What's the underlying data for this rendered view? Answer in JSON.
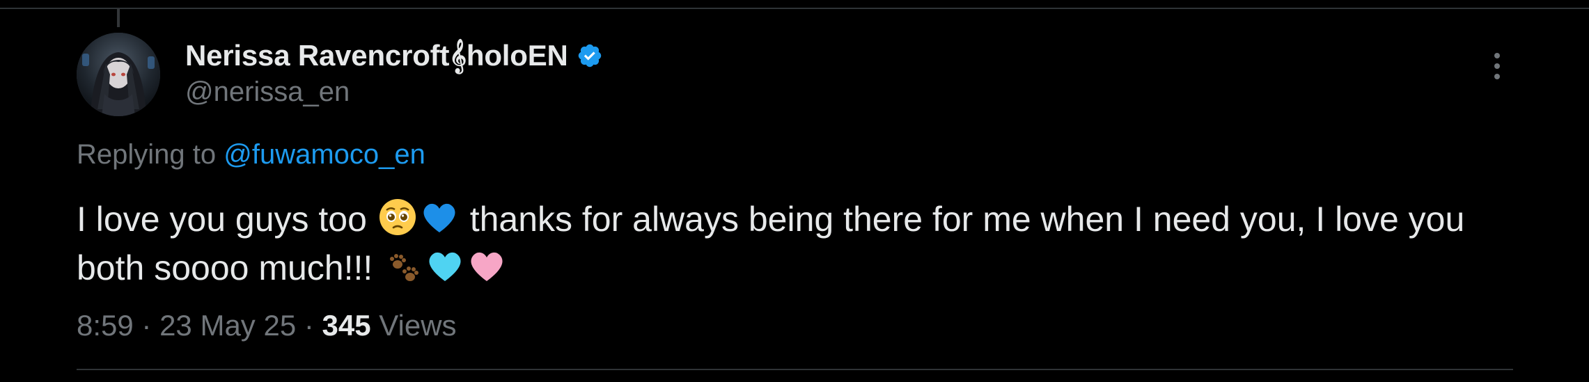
{
  "tweet": {
    "author": {
      "display_name": "Nerissa Ravencroft𝄞holoEN",
      "handle": "@nerissa_en",
      "verified": true,
      "avatar_icon": "avatar-image"
    },
    "replying": {
      "prefix": "Replying to ",
      "mention": "@fuwamoco_en"
    },
    "text": {
      "part1": "I love you guys too ",
      "emoji1": "pleading-face",
      "emoji2": "blue-heart",
      "part2": " thanks for always being there for me when I need you, I love you both soooo much!!! ",
      "emoji3": "paw-prints",
      "emoji4": "light-blue-heart",
      "emoji5": "pink-heart"
    },
    "meta": {
      "time": "8:59",
      "sep1": " · ",
      "date": "23 May 25",
      "sep2": " · ",
      "views_count": "345",
      "views_label": " Views"
    }
  },
  "colors": {
    "background": "#000000",
    "text": "#e7e9ea",
    "muted": "#71767b",
    "accent": "#1d9bf0",
    "divider": "#2f3336"
  },
  "icons": {
    "verified": "verified-badge-icon",
    "more": "more-vertical-icon"
  }
}
